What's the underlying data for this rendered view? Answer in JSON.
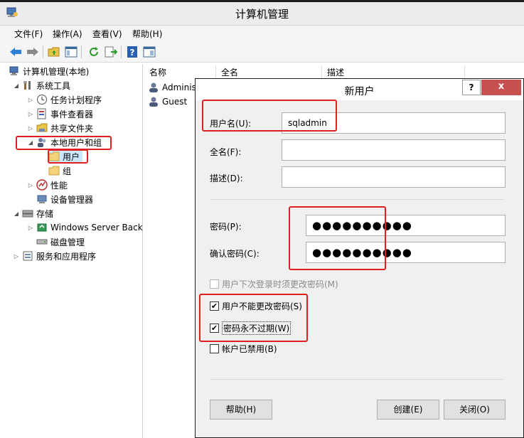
{
  "window": {
    "title": "计算机管理"
  },
  "menu": [
    "文件(F)",
    "操作(A)",
    "查看(V)",
    "帮助(H)"
  ],
  "toolbar": {
    "buttons": [
      "back-icon",
      "forward-icon",
      "up-folder-icon",
      "show-hide-tree-icon",
      "refresh-icon",
      "export-list-icon",
      "help-icon",
      "properties-icon"
    ]
  },
  "tree": {
    "root": "计算机管理(本地)",
    "system_tools": "系统工具",
    "task_scheduler": "任务计划程序",
    "event_viewer": "事件查看器",
    "shared_folders": "共享文件夹",
    "local_users_groups": "本地用户和组",
    "users": "用户",
    "groups": "组",
    "performance": "性能",
    "device_manager": "设备管理器",
    "storage": "存储",
    "windows_backup": "Windows Server Back",
    "disk_management": "磁盘管理",
    "services_apps": "服务和应用程序"
  },
  "list": {
    "columns": [
      "名称",
      "全名",
      "描述"
    ],
    "rows": [
      {
        "name": "Administ"
      },
      {
        "name": "Guest"
      }
    ]
  },
  "dialog": {
    "title": "新用户",
    "help_button": "?",
    "close_button": "x",
    "username_label": "用户名(U):",
    "username_value": "sqladmin",
    "fullname_label": "全名(F):",
    "fullname_value": "",
    "description_label": "描述(D):",
    "description_value": "",
    "password_label": "密码(P):",
    "password_value": "●●●●●●●●●●",
    "confirm_label": "确认密码(C):",
    "confirm_value": "●●●●●●●●●●",
    "opt_change_at_logon": "用户下次登录时须更改密码(M)",
    "opt_cannot_change": "用户不能更改密码(S)",
    "opt_never_expires": "密码永不过期(W)",
    "opt_disabled": "帐户已禁用(B)",
    "btn_help": "帮助(H)",
    "btn_create": "创建(E)",
    "btn_close": "关闭(O)"
  },
  "colors": {
    "highlight_red": "#e02020",
    "close_button": "#c75050",
    "selected_item": "#cce8ff"
  }
}
